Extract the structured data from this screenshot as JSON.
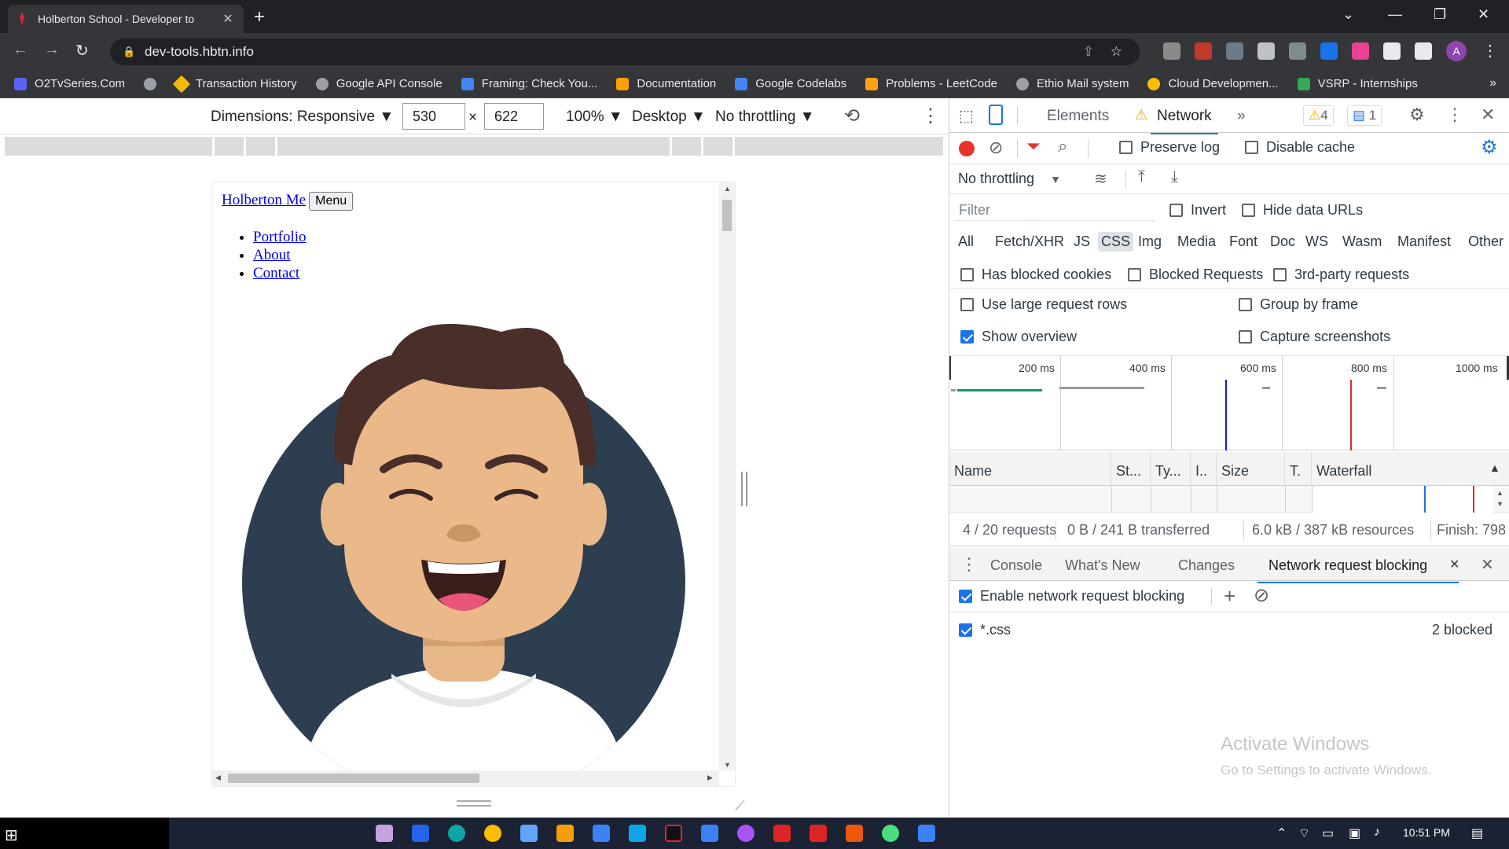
{
  "browser": {
    "tab_title": "Holberton School - Developer to",
    "tab_close": "✕",
    "new_tab": "+",
    "url": "dev-tools.hbtn.info",
    "profile_initial": "A",
    "bookmarks": [
      {
        "label": "O2TvSeries.Com",
        "color": "#5865f2"
      },
      {
        "label": "",
        "color": "#9aa0a6"
      },
      {
        "label": "Transaction History",
        "color": "#f0b90b"
      },
      {
        "label": "Google API Console",
        "color": "#9aa0a6"
      },
      {
        "label": "Framing: Check You...",
        "color": "#4285f4"
      },
      {
        "label": "Documentation",
        "color": "#ffa000"
      },
      {
        "label": "Google Codelabs",
        "color": "#4285f4"
      },
      {
        "label": "Problems - LeetCode",
        "color": "#ffa116"
      },
      {
        "label": "Ethio Mail system",
        "color": "#9aa0a6"
      },
      {
        "label": "Cloud Developmen...",
        "color": "#fbbc04"
      },
      {
        "label": "VSRP - Internships",
        "color": "#34a853"
      }
    ],
    "bookmarks_more": "»"
  },
  "device_toolbar": {
    "dimensions_label": "Dimensions: Responsive",
    "width": "530",
    "times": "×",
    "height": "622",
    "zoom": "100%",
    "device_type": "Desktop",
    "throttling": "No throttling"
  },
  "page": {
    "home_link": "Holberton Me",
    "menu_button": "Menu",
    "nav_links": [
      "Portfolio",
      "About",
      "Contact"
    ]
  },
  "devtools": {
    "tabs": {
      "elements": "Elements",
      "network": "Network",
      "more": "»"
    },
    "warnings_count": "4",
    "messages_count": "1",
    "toolbar": {
      "preserve_log": "Preserve log",
      "disable_cache": "Disable cache",
      "throttling": "No throttling"
    },
    "filter": {
      "placeholder": "Filter",
      "invert": "Invert",
      "hide_data_urls": "Hide data URLs",
      "types": [
        "All",
        "Fetch/XHR",
        "JS",
        "CSS",
        "Img",
        "Media",
        "Font",
        "Doc",
        "WS",
        "Wasm",
        "Manifest",
        "Other"
      ],
      "selected_type": "CSS",
      "has_blocked_cookies": "Has blocked cookies",
      "blocked_requests": "Blocked Requests",
      "third_party": "3rd-party requests"
    },
    "settings": {
      "large_rows": "Use large request rows",
      "group_by_frame": "Group by frame",
      "show_overview": "Show overview",
      "capture_screenshots": "Capture screenshots"
    },
    "overview_ticks": [
      "200 ms",
      "400 ms",
      "600 ms",
      "800 ms",
      "1000 ms"
    ],
    "columns": [
      "Name",
      "St...",
      "Ty...",
      "I..",
      "Size",
      "T.",
      "Waterfall"
    ],
    "sort_indicator": "▲",
    "summary": {
      "requests": "4 / 20 requests",
      "transferred": "0 B / 241 B transferred",
      "resources": "6.0 kB / 387 kB resources",
      "finish": "Finish: 798"
    },
    "drawer": {
      "tabs": [
        "Console",
        "What's New",
        "Changes",
        "Network request blocking"
      ],
      "enable_label": "Enable network request blocking",
      "pattern": "*.css",
      "blocked_count": "2 blocked"
    }
  },
  "watermark": {
    "title": "Activate Windows",
    "subtitle": "Go to Settings to activate Windows."
  },
  "taskbar": {
    "time": "10:51 PM"
  }
}
